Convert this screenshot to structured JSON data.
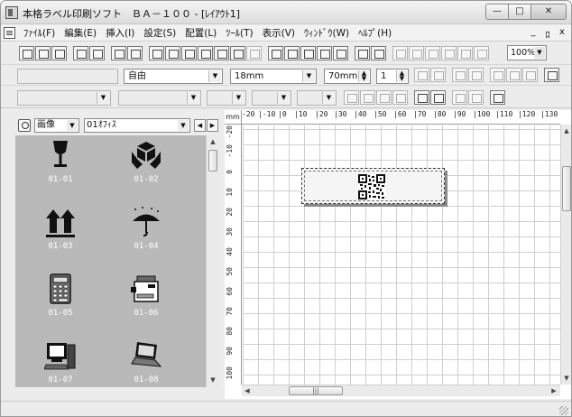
{
  "window": {
    "title": "本格ラベル印刷ソフト　ＢＡ－１００ - [ﾚｲｱｳﾄ1]",
    "controls": {
      "minimize": "—",
      "maximize": "□",
      "close": "✕"
    }
  },
  "menubar": {
    "items": [
      "ﾌｧｲﾙ(F)",
      "編集(E)",
      "挿入(I)",
      "設定(S)",
      "配置(L)",
      "ﾂｰﾙ(T)",
      "表示(V)",
      "ｳｨﾝﾄﾞｳ(W)",
      "ﾍﾙﾌﾟ(H)"
    ],
    "mdi": {
      "minimize": "_",
      "restore": "ﾛ",
      "close": "x"
    }
  },
  "toolbar": {
    "zoom": "100%"
  },
  "format_bar": {
    "font_name": "",
    "alignment": "自由",
    "font_size": "18mm",
    "width": "70mm",
    "count": "1"
  },
  "gallery": {
    "type": "画像",
    "category": "01ｵﾌｨｽ",
    "items": [
      {
        "code": "01-01",
        "icon": "fragile-glass-icon"
      },
      {
        "code": "01-02",
        "icon": "handle-with-care-icon"
      },
      {
        "code": "01-03",
        "icon": "this-way-up-icon"
      },
      {
        "code": "01-04",
        "icon": "keep-dry-umbrella-icon"
      },
      {
        "code": "01-05",
        "icon": "calculator-icon"
      },
      {
        "code": "01-06",
        "icon": "copier-icon"
      },
      {
        "code": "01-07",
        "icon": "desktop-computer-icon"
      },
      {
        "code": "01-08",
        "icon": "laptop-icon"
      }
    ]
  },
  "ruler": {
    "unit": "mm",
    "h_ticks": [
      "-20",
      "|-10",
      "|0",
      "|10",
      "|20",
      "|30",
      "|40",
      "|50",
      "|60",
      "|70",
      "|80",
      "|90",
      "|100",
      "|110",
      "|120",
      "|130"
    ],
    "v_ticks": [
      "-20",
      "-10",
      "0",
      "10",
      "20",
      "30",
      "40",
      "50",
      "60",
      "70",
      "80",
      "90",
      "100"
    ]
  },
  "statusbar": {
    "text": ""
  }
}
